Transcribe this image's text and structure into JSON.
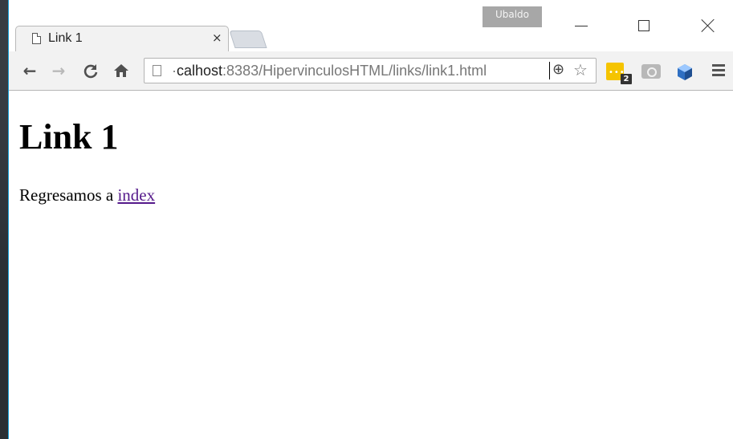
{
  "window": {
    "profile_name": "Ubaldo"
  },
  "tab": {
    "title": "Link 1",
    "close_glyph": "×"
  },
  "toolbar": {
    "back_glyph": "←",
    "forward_glyph": "→",
    "reload_glyph": "C",
    "home_glyph": "⌂",
    "address_prefix": "·",
    "address_host": "calhost",
    "address_rest": ":8383/HipervinculosHTML/links/link1.html",
    "zoom_glyph": "⊕",
    "star_glyph": "☆",
    "extension_badge": "2"
  },
  "page": {
    "heading": "Link 1",
    "paragraph_text": "Regresamos a ",
    "link_text": "index"
  },
  "colors": {
    "window_border": "#16a0d8",
    "visited_link": "#551a8b",
    "extension_yellow": "#f5c400"
  }
}
